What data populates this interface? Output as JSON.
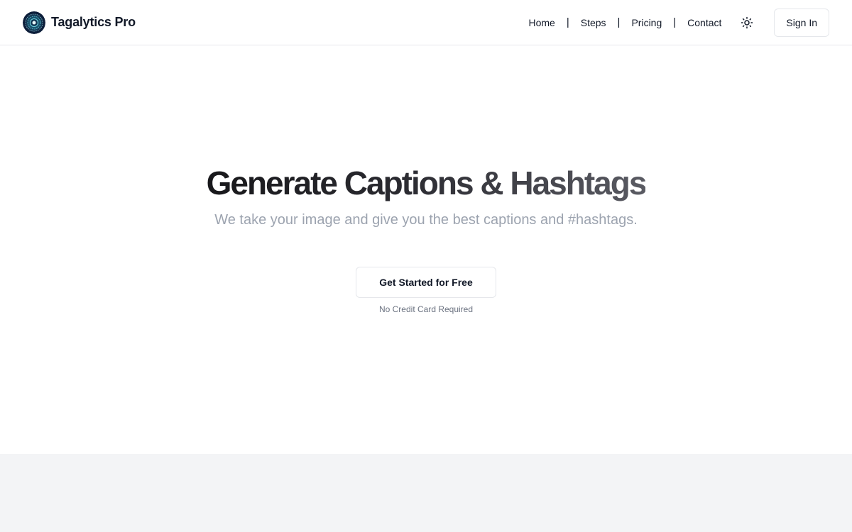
{
  "header": {
    "brand_name": "Tagalytics Pro",
    "logo_icon": "circuit-eye-logo",
    "nav_links": [
      {
        "label": "Home"
      },
      {
        "label": "Steps"
      },
      {
        "label": "Pricing"
      },
      {
        "label": "Contact"
      }
    ],
    "separator": "|",
    "theme_toggle_icon": "sun-icon",
    "signin_label": "Sign In"
  },
  "hero": {
    "title": "Generate Captions & Hashtags",
    "subtitle": "We take your image and give you the best captions and #hashtags.",
    "cta_label": "Get Started for Free",
    "cta_note": "No Credit Card Required"
  },
  "colors": {
    "text_primary": "#111827",
    "subtitle_gray": "#9ca3af",
    "border": "#e5e7eb",
    "section_bg": "#f3f4f6"
  }
}
